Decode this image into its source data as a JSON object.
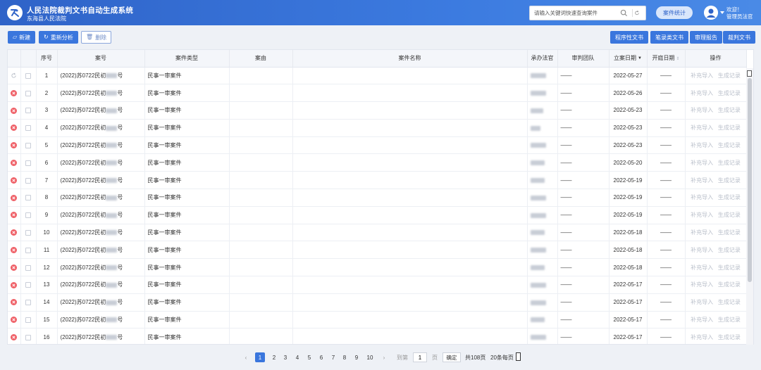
{
  "app": {
    "title": "人民法院裁判文书自动生成系统",
    "subtitle": "东海县人民法院",
    "search_placeholder": "请输入关键词快速查询案件",
    "stats_label": "案件统计",
    "welcome_line1": "欢迎！",
    "welcome_line2": "管理员法官"
  },
  "toolbar": {
    "new_label": "新建",
    "reanalyze_label": "重新分析",
    "delete_label": "删除",
    "procedural_label": "程序性文书",
    "transcript_label": "笔录类文书",
    "trial_report_label": "审理报告",
    "judgment_label": "裁判文书"
  },
  "table": {
    "headers": {
      "seq": "序号",
      "case_no": "案号",
      "case_type": "案件类型",
      "cause": "案由",
      "case_name": "案件名称",
      "judge": "承办法官",
      "panel": "审判团队",
      "filing_date": "立案日期",
      "hearing_date": "开庭日期",
      "ops": "操作"
    },
    "op_import": "补充导入",
    "op_record": "生成记录",
    "rows": [
      {
        "seq": "1",
        "case_prefix": "(2022)苏0722民初",
        "suffix": "号",
        "type": "民事一审案件",
        "panel": "——",
        "date": "2022-05-27",
        "hearing": "——",
        "status": "pending"
      },
      {
        "seq": "2",
        "case_prefix": "(2022)苏0722民初",
        "suffix": "号",
        "type": "民事一审案件",
        "panel": "——",
        "date": "2022-05-26",
        "hearing": "——",
        "status": "error"
      },
      {
        "seq": "3",
        "case_prefix": "(2022)苏0722民初",
        "suffix": "号",
        "type": "民事一审案件",
        "panel": "——",
        "date": "2022-05-23",
        "hearing": "——",
        "status": "error"
      },
      {
        "seq": "4",
        "case_prefix": "(2022)苏0722民初",
        "suffix": "号",
        "type": "民事一审案件",
        "panel": "——",
        "date": "2022-05-23",
        "hearing": "——",
        "status": "error"
      },
      {
        "seq": "5",
        "case_prefix": "(2022)苏0722民初",
        "suffix": "号",
        "type": "民事一审案件",
        "panel": "——",
        "date": "2022-05-23",
        "hearing": "——",
        "status": "error"
      },
      {
        "seq": "6",
        "case_prefix": "(2022)苏0722民初",
        "suffix": "号",
        "type": "民事一审案件",
        "panel": "——",
        "date": "2022-05-20",
        "hearing": "——",
        "status": "error"
      },
      {
        "seq": "7",
        "case_prefix": "(2022)苏0722民初",
        "suffix": "号",
        "type": "民事一审案件",
        "panel": "——",
        "date": "2022-05-19",
        "hearing": "——",
        "status": "error"
      },
      {
        "seq": "8",
        "case_prefix": "(2022)苏0722民初",
        "suffix": "号",
        "type": "民事一审案件",
        "panel": "——",
        "date": "2022-05-19",
        "hearing": "——",
        "status": "error"
      },
      {
        "seq": "9",
        "case_prefix": "(2022)苏0722民初",
        "suffix": "号",
        "type": "民事一审案件",
        "panel": "——",
        "date": "2022-05-19",
        "hearing": "——",
        "status": "error"
      },
      {
        "seq": "10",
        "case_prefix": "(2022)苏0722民初",
        "suffix": "号",
        "type": "民事一审案件",
        "panel": "——",
        "date": "2022-05-18",
        "hearing": "——",
        "status": "error"
      },
      {
        "seq": "11",
        "case_prefix": "(2022)苏0722民初",
        "suffix": "号",
        "type": "民事一审案件",
        "panel": "——",
        "date": "2022-05-18",
        "hearing": "——",
        "status": "error"
      },
      {
        "seq": "12",
        "case_prefix": "(2022)苏0722民初",
        "suffix": "号",
        "type": "民事一审案件",
        "panel": "——",
        "date": "2022-05-18",
        "hearing": "——",
        "status": "error"
      },
      {
        "seq": "13",
        "case_prefix": "(2022)苏0722民初",
        "suffix": "号",
        "type": "民事一审案件",
        "panel": "——",
        "date": "2022-05-17",
        "hearing": "——",
        "status": "error"
      },
      {
        "seq": "14",
        "case_prefix": "(2022)苏0722民初",
        "suffix": "号",
        "type": "民事一审案件",
        "panel": "——",
        "date": "2022-05-17",
        "hearing": "——",
        "status": "error"
      },
      {
        "seq": "15",
        "case_prefix": "(2022)苏0722民初",
        "suffix": "号",
        "type": "民事一审案件",
        "panel": "——",
        "date": "2022-05-17",
        "hearing": "——",
        "status": "error"
      },
      {
        "seq": "16",
        "case_prefix": "(2022)苏0722民初",
        "suffix": "号",
        "type": "民事一审案件",
        "panel": "——",
        "date": "2022-05-17",
        "hearing": "——",
        "status": "error"
      }
    ]
  },
  "pagination": {
    "pages": [
      "1",
      "2",
      "3",
      "4",
      "5",
      "6",
      "7",
      "8",
      "9",
      "10"
    ],
    "current": "1",
    "goto_label": "到第",
    "goto_value": "1",
    "page_unit": "页",
    "confirm_label": "确定",
    "total_label": "共108页",
    "page_size_label": "20条每页"
  },
  "colors": {
    "header_blue": "#2f63c8",
    "primary": "#3a76dd",
    "error_red": "#ef5f66"
  }
}
